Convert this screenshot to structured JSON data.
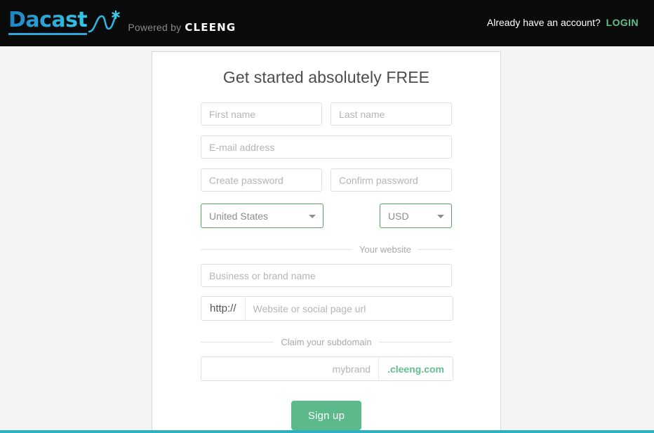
{
  "header": {
    "logo_text": "Dacast",
    "logo_icon": "wave-asterisk-mark",
    "powered_by": "Powered by",
    "partner_name": "CLEENG",
    "account_prompt": "Already have an account?",
    "login_label": "LOGIN",
    "background": "#0a0a0a",
    "login_color": "#63c08e"
  },
  "signup": {
    "title": "Get started absolutely FREE",
    "first_name": {
      "placeholder": "First name",
      "value": ""
    },
    "last_name": {
      "placeholder": "Last name",
      "value": ""
    },
    "email": {
      "placeholder": "E-mail address",
      "value": ""
    },
    "create_password": {
      "placeholder": "Create password",
      "value": ""
    },
    "confirm_password": {
      "placeholder": "Confirm password",
      "value": ""
    },
    "country": {
      "selected": "United States",
      "caret": "chevron-down-icon"
    },
    "currency": {
      "selected": "USD",
      "caret": "chevron-down-icon"
    },
    "website_divider": "Your website",
    "business_name": {
      "placeholder": "Business or brand name",
      "value": ""
    },
    "website_url": {
      "prefix": "http://",
      "placeholder": "Website or social page url",
      "value": ""
    },
    "subdomain_divider": "Claim your subdomain",
    "subdomain": {
      "placeholder": "mybrand",
      "value": "",
      "suffix": ".cleeng.com"
    },
    "submit_label": "Sign up",
    "submit_color": "#5cba8a",
    "valid_border_color": "#5a9e63",
    "accent_bar_color": "#2bb0c4"
  }
}
